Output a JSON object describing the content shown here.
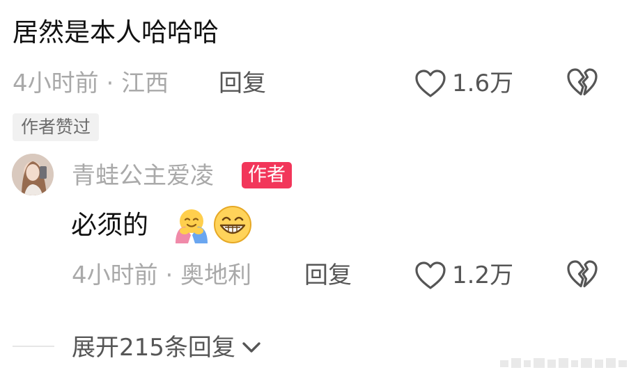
{
  "comment": {
    "text": "居然是本人哈哈哈",
    "time": "4小时前",
    "separator": "·",
    "location": "江西",
    "reply_label": "回复",
    "like_count": "1.6万",
    "like_icon": "heart-outline-icon",
    "dislike_icon": "broken-heart-icon",
    "author_liked_tag": "作者赞过"
  },
  "reply": {
    "username": "青蛙公主爱凌",
    "author_badge": "作者",
    "text": "必须的",
    "emojis": [
      "hug-emoji",
      "grin-emoji"
    ],
    "time": "4小时前",
    "separator": "·",
    "location": "奥地利",
    "reply_label": "回复",
    "like_count": "1.2万",
    "like_icon": "heart-outline-icon",
    "dislike_icon": "broken-heart-icon"
  },
  "expand": {
    "label": "展开215条回复",
    "icon": "chevron-down-icon"
  },
  "colors": {
    "badge": "#f2365a",
    "meta_gray": "#a9a9a9",
    "action_gray": "#555555",
    "text": "#111111"
  }
}
